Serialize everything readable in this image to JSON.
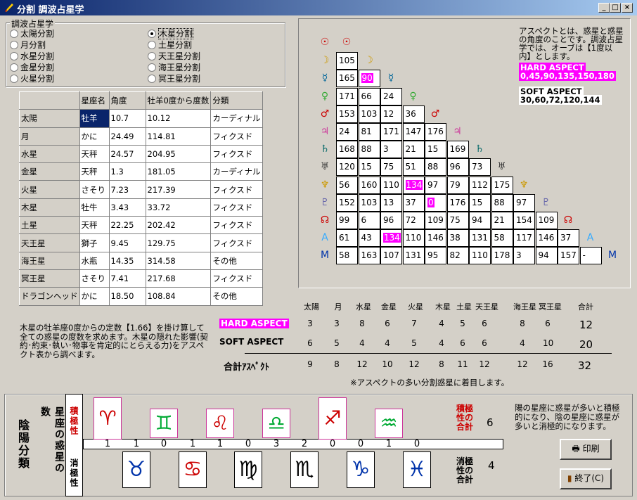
{
  "window": {
    "title": "分割  調波占星学",
    "min": "_",
    "max": "□",
    "close": "×"
  },
  "group": {
    "label": "調波占星学",
    "left": [
      "太陽分割",
      "月分割",
      "水星分割",
      "金星分割",
      "火星分割"
    ],
    "right": [
      "木星分割",
      "土星分割",
      "天王星分割",
      "海王星分割",
      "冥王星分割"
    ],
    "selected": "木星分割"
  },
  "table": {
    "headers": [
      "",
      "星座名",
      "角度",
      "牡羊0度から度数",
      "分類"
    ],
    "rows": [
      [
        "太陽",
        "牡羊",
        "10.7",
        "10.12",
        "カーディナル"
      ],
      [
        "月",
        "かに",
        "24.49",
        "114.81",
        "フィクスド"
      ],
      [
        "水星",
        "天秤",
        "24.57",
        "204.95",
        "フィクスド"
      ],
      [
        "金星",
        "天秤",
        "1.3",
        "181.05",
        "カーディナル"
      ],
      [
        "火星",
        "さそり",
        "7.23",
        "217.39",
        "フィクスド"
      ],
      [
        "木星",
        "牡牛",
        "3.43",
        "33.72",
        "フィクスド"
      ],
      [
        "土星",
        "天秤",
        "22.25",
        "202.42",
        "フィクスド"
      ],
      [
        "天王星",
        "獅子",
        "9.45",
        "129.75",
        "フィクスド"
      ],
      [
        "海王星",
        "水瓶",
        "14.35",
        "314.58",
        "その他"
      ],
      [
        "冥王星",
        "さそり",
        "7.41",
        "217.68",
        "フィクスド"
      ],
      [
        "ドラゴンヘッド",
        "かに",
        "18.50",
        "108.84",
        "その他"
      ]
    ]
  },
  "aspect_grid": {
    "symbols": [
      "☉",
      "☽",
      "☿",
      "♀",
      "♂",
      "♃",
      "♄",
      "♅",
      "♆",
      "♇",
      "☊",
      "A",
      "M"
    ],
    "rows": [
      [
        "105"
      ],
      [
        "165",
        "90"
      ],
      [
        "171",
        "66",
        "24"
      ],
      [
        "153",
        "103",
        "12",
        "36"
      ],
      [
        "24",
        "81",
        "171",
        "147",
        "176"
      ],
      [
        "168",
        "88",
        "3",
        "21",
        "15",
        "169"
      ],
      [
        "120",
        "15",
        "75",
        "51",
        "88",
        "96",
        "73"
      ],
      [
        "56",
        "160",
        "110",
        "134",
        "97",
        "79",
        "112",
        "175"
      ],
      [
        "152",
        "103",
        "13",
        "37",
        "0",
        "176",
        "15",
        "88",
        "97"
      ],
      [
        "99",
        "6",
        "96",
        "72",
        "109",
        "75",
        "94",
        "21",
        "154",
        "109"
      ],
      [
        "61",
        "43",
        "134",
        "110",
        "146",
        "38",
        "131",
        "58",
        "117",
        "146",
        "37"
      ],
      [
        "58",
        "163",
        "107",
        "131",
        "95",
        "82",
        "110",
        "178",
        "3",
        "94",
        "157",
        "-"
      ]
    ],
    "magenta": [
      [
        1,
        1
      ],
      [
        7,
        3
      ],
      [
        8,
        4
      ],
      [
        10,
        2
      ]
    ]
  },
  "aspect_info": {
    "text": "アスペクトとは、惑星と惑星の角度のことです。調波占星学では、オーブは【1度以内】とします。",
    "hard_label": "HARD ASPECT",
    "hard_values": "0,45,90,135,150,180",
    "soft_label": "SOFT ASPECT",
    "soft_values": "30,60,72,120,144"
  },
  "stats": {
    "headers": [
      "太陽",
      "月",
      "水星",
      "金星",
      "火星",
      "木星",
      "土星",
      "天王星",
      "海王星",
      "冥王星",
      "合計"
    ],
    "hard_label": "HARD ASPECT",
    "soft_label": "SOFT ASPECT",
    "total_label": "合計ｱｽﾍﾟｸﾄ",
    "hard": [
      "3",
      "3",
      "8",
      "6",
      "7",
      "4",
      "5",
      "6",
      "8",
      "6",
      "12"
    ],
    "soft": [
      "6",
      "5",
      "4",
      "4",
      "5",
      "4",
      "6",
      "6",
      "4",
      "10",
      "20"
    ],
    "total": [
      "9",
      "8",
      "12",
      "10",
      "12",
      "8",
      "11",
      "12",
      "12",
      "16",
      "32"
    ],
    "note": "※アスペクトの多い分割惑星に着目します。"
  },
  "description": "木星の牡羊座0度からの定数【1.66】を掛け算して全ての惑星の度数を求めます。木星の隠れた影響(契約･約束･執い･物事を肯定的にとらえる力)をアスペクト表から調べます。",
  "bottom": {
    "side_title": "陰陽分類",
    "side_sub": "星座の惑星の数",
    "active_label": "積極性",
    "passive_label": "消極性",
    "counts": [
      "1",
      "1",
      "0",
      "1",
      "1",
      "0",
      "3",
      "2",
      "0",
      "0",
      "1",
      "0"
    ],
    "zodiac": [
      "♈",
      "♉",
      "♊",
      "♋",
      "♌",
      "♍",
      "♎",
      "♏",
      "♐",
      "♑",
      "♒",
      "♓"
    ],
    "active_total_label": "積極性の合計",
    "active_total": "6",
    "passive_total_label": "消極性の合計",
    "passive_total": "4",
    "note": "陽の星座に惑星が多いと積極的になり、陰の星座に惑星が多いと消極的になります。",
    "print_button": "印刷",
    "exit_button": "終了(C)"
  },
  "colors": {
    "magenta": "#ff00ff",
    "title_blue": "#0a246a",
    "active_red": "#cc0000"
  }
}
